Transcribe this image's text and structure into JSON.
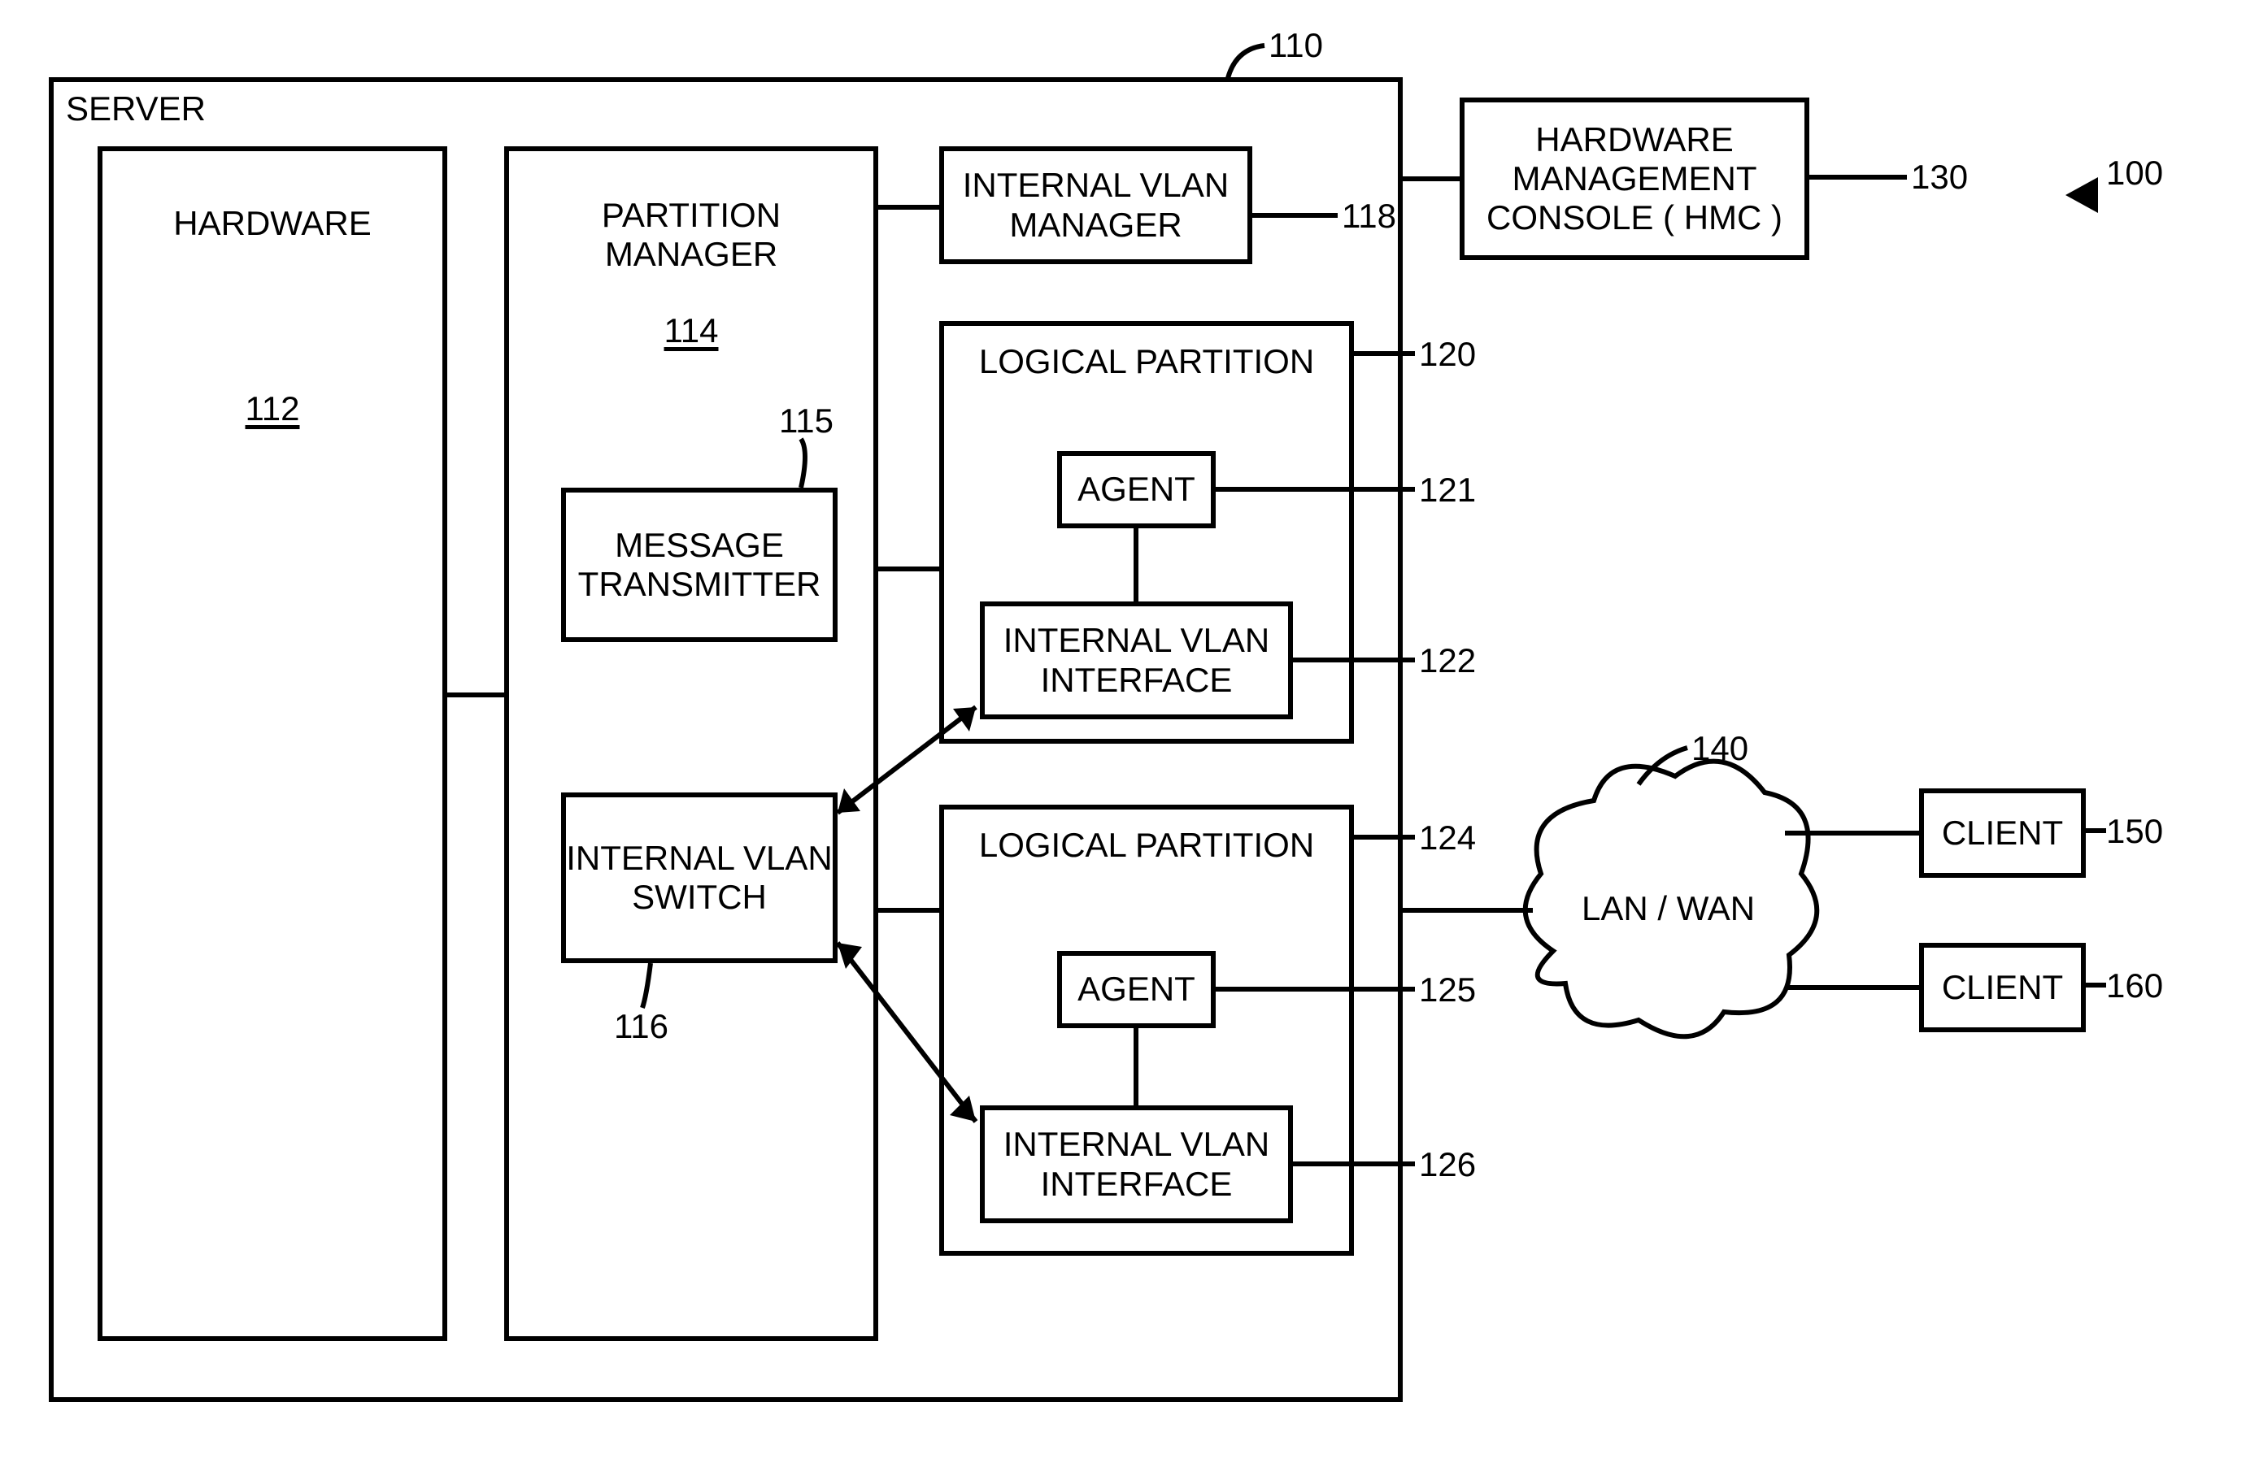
{
  "diagram": {
    "server_label": "SERVER",
    "hardware": {
      "title": "HARDWARE",
      "ref": "112"
    },
    "partition_manager": {
      "title": "PARTITION",
      "title2": "MANAGER",
      "ref": "114",
      "message_transmitter": {
        "line1": "MESSAGE",
        "line2": "TRANSMITTER"
      },
      "msg_tx_ref": "115",
      "vlan_switch": {
        "line1": "INTERNAL VLAN",
        "line2": "SWITCH"
      },
      "vlan_switch_ref": "116"
    },
    "vlan_manager": {
      "line1": "INTERNAL VLAN",
      "line2": "MANAGER"
    },
    "vlan_manager_ref": "118",
    "lp1": {
      "title": "LOGICAL PARTITION",
      "ref": "120",
      "agent": "AGENT",
      "agent_ref": "121",
      "iface": {
        "line1": "INTERNAL VLAN",
        "line2": "INTERFACE"
      },
      "iface_ref": "122"
    },
    "lp2": {
      "title": "LOGICAL PARTITION",
      "ref": "124",
      "agent": "AGENT",
      "agent_ref": "125",
      "iface": {
        "line1": "INTERNAL VLAN",
        "line2": "INTERFACE"
      },
      "iface_ref": "126"
    },
    "hmc": {
      "line1": "HARDWARE",
      "line2": "MANAGEMENT",
      "line3": "CONSOLE ( HMC )"
    },
    "hmc_ref": "130",
    "overall_ref": "100",
    "server_ref": "110",
    "cloud": "LAN / WAN",
    "cloud_ref": "140",
    "client1": "CLIENT",
    "client1_ref": "150",
    "client2": "CLIENT",
    "client2_ref": "160"
  }
}
